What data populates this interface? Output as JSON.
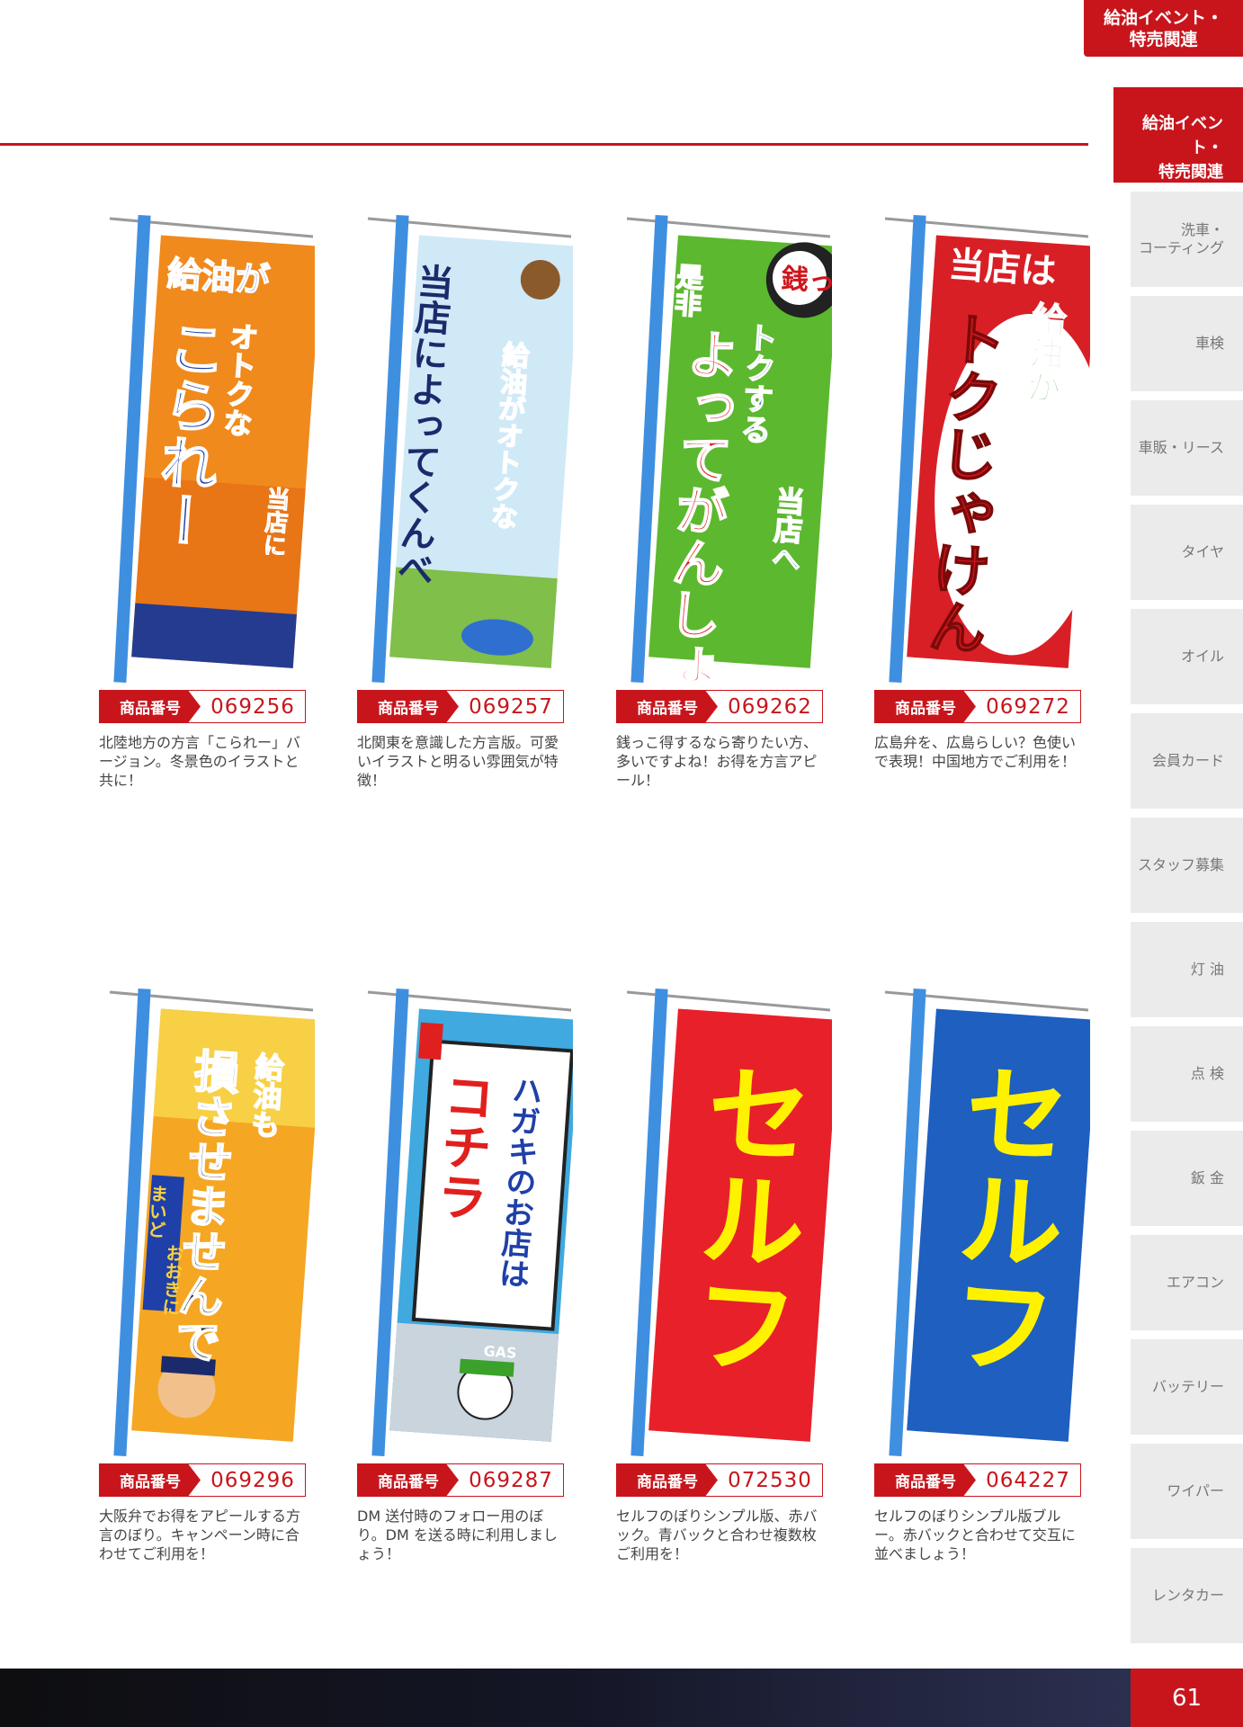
{
  "header": {
    "top_tab": "給油イベント・\n特売関連",
    "section_tab_line1": "給油イベント・",
    "section_tab_line2": "特売関連"
  },
  "sidebar": {
    "items": [
      {
        "label": "洗車・\nコーティング"
      },
      {
        "label": "車検"
      },
      {
        "label": "車販・リース"
      },
      {
        "label": "タイヤ"
      },
      {
        "label": "オイル"
      },
      {
        "label": "会員カード"
      },
      {
        "label": "スタッフ募集"
      },
      {
        "label": "灯 油"
      },
      {
        "label": "点 検"
      },
      {
        "label": "鈑 金"
      },
      {
        "label": "エアコン"
      },
      {
        "label": "バッテリー"
      },
      {
        "label": "ワイパー"
      },
      {
        "label": "レンタカー"
      }
    ]
  },
  "code_label": "商品番号",
  "products": [
    {
      "code": "069256",
      "desc": "北陸地方の方言「こられー」バージョン。冬景色のイラストと共に！",
      "banner": {
        "bg": "#f08a1c",
        "texts": [
          "給油が",
          "オトクな",
          "当店に",
          "こられー"
        ]
      }
    },
    {
      "code": "069257",
      "desc": "北関東を意識した方言版。可愛いイラストと明るい雰囲気が特徴！",
      "banner": {
        "bg": "#cfe9f7",
        "texts": [
          "当店によってくんべ",
          "給油がオトクな"
        ]
      }
    },
    {
      "code": "069262",
      "desc": "銭っこ得するなら寄りたい方、多いですよね！お得を方言アピール！",
      "banner": {
        "bg": "#5cb82e",
        "texts": [
          "銭っこ",
          "是非",
          "トクする",
          "当店へ",
          "よってがんしょ"
        ]
      }
    },
    {
      "code": "069272",
      "desc": "広島弁を、広島らしい？色使いで表現！中国地方でご利用を！",
      "banner": {
        "bg": "#d81f26",
        "texts": [
          "当店は",
          "給油が",
          "トクじゃけん"
        ]
      }
    },
    {
      "code": "069296",
      "desc": "大阪弁でお得をアピールする方言のぼり。キャンペーン時に合わせてご利用を！",
      "banner": {
        "bg": "#f5a623",
        "texts": [
          "給油も",
          "損させませんで",
          "まいど",
          "おおきに"
        ]
      }
    },
    {
      "code": "069287",
      "desc": "DM 送付時のフォロー用のぼり。DM を送る時に利用しましょう！",
      "banner": {
        "bg": "#3fa9e0",
        "texts": [
          "ハガキのお店は",
          "コチラ",
          "GAS"
        ]
      }
    },
    {
      "code": "072530",
      "desc": "セルフのぼりシンプル版、赤バック。青バックと合わせ複数枚ご利用を！",
      "banner": {
        "bg": "#e8202a",
        "texts": [
          "セルフ"
        ]
      }
    },
    {
      "code": "064227",
      "desc": "セルフのぼりシンプル版ブルー。赤バックと合わせて交互に並べましょう！",
      "banner": {
        "bg": "#1e5fc0",
        "texts": [
          "セルフ"
        ]
      }
    }
  ],
  "page_number": "61",
  "colors": {
    "accent": "#c8151c",
    "sidebar_bg": "#ebebeb"
  }
}
